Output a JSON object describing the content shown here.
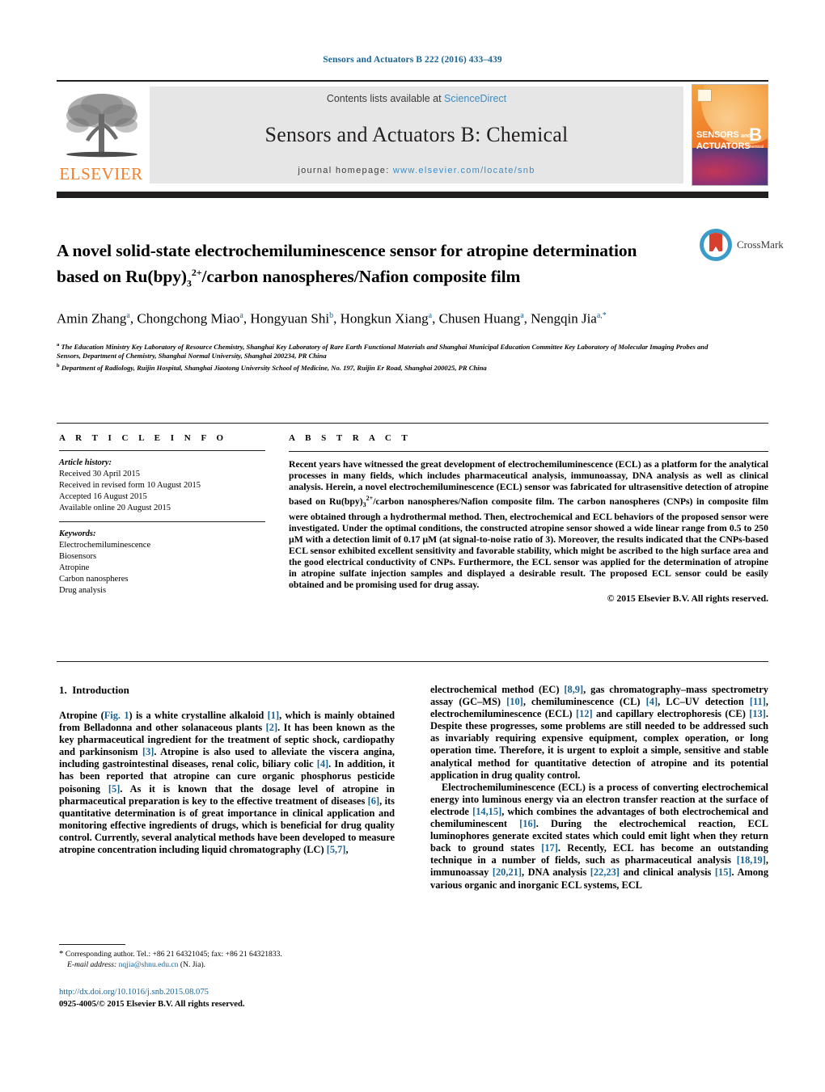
{
  "running_head": "Sensors and Actuators B 222 (2016) 433–439",
  "masthead": {
    "publisher_name": "ELSEVIER",
    "contents_prefix": "Contents lists available at ",
    "contents_link": "ScienceDirect",
    "journal_name": "Sensors and Actuators B: Chemical",
    "homepage_prefix": "journal homepage: ",
    "homepage_url": "www.elsevier.com/locate/snb",
    "cover_line1": "SENSORS",
    "cover_line1_sm": "and",
    "cover_line2": "ACTUATORS",
    "cover_volume": "B",
    "cover_volume_sub": "Chemical"
  },
  "article": {
    "title_line1": "A novel solid-state electrochemiluminescence sensor for atropine",
    "title_line2_a": "determination based on Ru(bpy)",
    "title_line2_sub": "3",
    "title_line2_sup": "2+",
    "title_line2_b": "/carbon nanospheres/Nafion",
    "title_line3": "composite film",
    "crossmark_label": "CrossMark",
    "authors": [
      {
        "name": "Amin Zhang",
        "mark": "a"
      },
      {
        "name": "Chongchong Miao",
        "mark": "a"
      },
      {
        "name": "Hongyuan Shi",
        "mark": "b"
      },
      {
        "name": "Hongkun Xiang",
        "mark": "a"
      },
      {
        "name": "Chusen Huang",
        "mark": "a"
      },
      {
        "name": "Nengqin Jia",
        "mark": "a,*"
      }
    ],
    "affiliations": [
      {
        "mark": "a",
        "text": "The Education Ministry Key Laboratory of Resource Chemistry, Shanghai Key Laboratory of Rare Earth Functional Materials and Shanghai Municipal Education Committee Key Laboratory of Molecular Imaging Probes and Sensors, Department of Chemistry, Shanghai Normal University, Shanghai 200234, PR China"
      },
      {
        "mark": "b",
        "text": "Department of Radiology, Ruijin Hospital, Shanghai Jiaotong University School of Medicine, No. 197, Ruijin Er Road, Shanghai 200025, PR China"
      }
    ]
  },
  "article_info": {
    "heading": "A R T I C L E    I N F O",
    "history_label": "Article history:",
    "history": [
      "Received 30 April 2015",
      "Received in revised form 10 August 2015",
      "Accepted 16 August 2015",
      "Available online 20 August 2015"
    ],
    "keywords_label": "Keywords:",
    "keywords": [
      "Electrochemiluminescence",
      "Biosensors",
      "Atropine",
      "Carbon nanospheres",
      "Drug analysis"
    ]
  },
  "abstract": {
    "heading": "A B S T R A C T",
    "part1": "Recent years have witnessed the great development of electrochemiluminescence (ECL) as a platform for the analytical processes in many fields, which includes pharmaceutical analysis, immunoassay, DNA analysis as well as clinical analysis. Herein, a novel electrochemiluminescence (ECL) sensor was fabricated for ultrasensitive detection of atropine based on Ru(bpy)",
    "sub": "3",
    "sup": "2+",
    "part2": "/carbon nanospheres/Nafion composite film. The carbon nanospheres (CNPs) in composite film were obtained through a hydrothermal method. Then, electrochemical and ECL behaviors of the proposed sensor were investigated. Under the optimal conditions, the constructed atropine sensor showed a wide linear range from 0.5 to 250 µM with a detection limit of 0.17 µM (at signal-to-noise ratio of 3). Moreover, the results indicated that the CNPs-based ECL sensor exhibited excellent sensitivity and favorable stability, which might be ascribed to the high surface area and the good electrical conductivity of CNPs. Furthermore, the ECL sensor was applied for the determination of atropine in atropine sulfate injection samples and displayed a desirable result. The proposed ECL sensor could be easily obtained and be promising used for drug assay.",
    "copyright": "© 2015 Elsevier B.V. All rights reserved."
  },
  "body": {
    "section_number": "1.",
    "section_title": "Introduction",
    "left_paragraphs": [
      "Atropine (Fig. 1) is a white crystalline alkaloid [1], which is mainly obtained from Belladonna and other solanaceous plants [2]. It has been known as the key pharmaceutical ingredient for the treatment of septic shock, cardiopathy and parkinsonism [3]. Atropine is also used to alleviate the viscera angina, including gastrointestinal diseases, renal colic, biliary colic [4]. In addition, it has been reported that atropine can cure organic phosphorus pesticide poisoning [5]. As it is known that the dosage level of atropine in pharmaceutical preparation is key to the effective treatment of diseases [6], its quantitative determination is of great importance in clinical application and monitoring effective ingredients of drugs, which is beneficial for drug quality control. Currently, several analytical methods have been developed to measure atropine concentration including liquid chromatography (LC) [5,7],"
    ],
    "right_paragraphs": [
      "electrochemical method (EC) [8,9], gas chromatography–mass spectrometry assay (GC–MS) [10], chemiluminescence (CL) [4], LC–UV detection [11], electrochemiluminescence (ECL) [12] and capillary electrophoresis (CE) [13]. Despite these progresses, some problems are still needed to be addressed such as invariably requiring expensive equipment, complex operation, or long operation time. Therefore, it is urgent to exploit a simple, sensitive and stable analytical method for quantitative detection of atropine and its potential application in drug quality control.",
      "Electrochemiluminescence (ECL) is a process of converting electrochemical energy into luminous energy via an electron transfer reaction at the surface of electrode [14,15], which combines the advantages of both electrochemical and chemiluminescent [16]. During the electrochemical reaction, ECL luminophores generate excited states which could emit light when they return back to ground states [17]. Recently, ECL has become an outstanding technique in a number of fields, such as pharmaceutical analysis [18,19], immunoassay [20,21], DNA analysis [22,23] and clinical analysis [15]. Among various organic and inorganic ECL systems, ECL"
    ]
  },
  "footer": {
    "corresponding_star": "*",
    "corresponding_text": "Corresponding author. Tel.: +86 21 64321045; fax: +86 21 64321833.",
    "email_label": "E-mail address:",
    "email": "nqjia@shnu.edu.cn",
    "email_suffix": "(N. Jia).",
    "doi": "http://dx.doi.org/10.1016/j.snb.2015.08.075",
    "issn_line": "0925-4005/© 2015 Elsevier B.V. All rights reserved."
  },
  "colors": {
    "link": "#1a6496",
    "science_direct": "#3c8cc4",
    "elsevier_orange": "#f0802b",
    "bar": "#231f20",
    "masthead_bg": "#e6e6e6"
  }
}
